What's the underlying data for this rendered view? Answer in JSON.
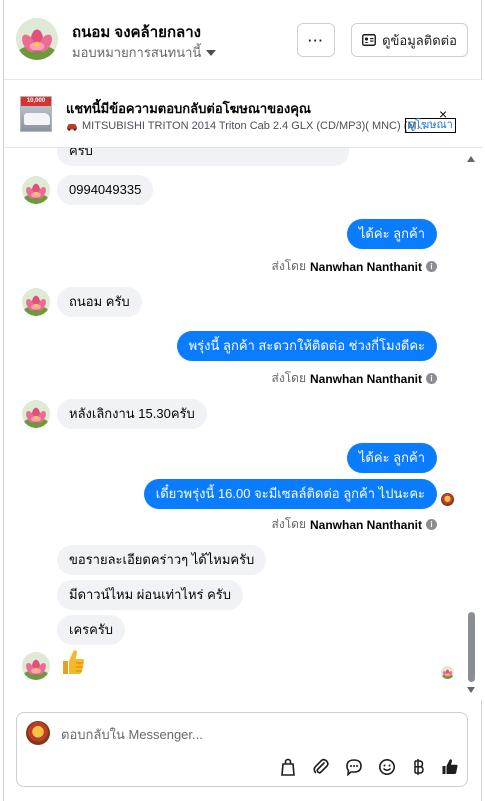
{
  "header": {
    "contact_name": "ถนอม จงคล้ายกลาง",
    "assign_label": "มอบหมายการสนทนานี้",
    "more_label": "···",
    "contact_info_label": "ดูข้อมูลติดต่อ"
  },
  "ad_banner": {
    "title": "แชทนี้มีข้อความตอบกลับต่อโฆษณาของคุณ",
    "subtitle": "MITSUBISHI TRITON 2014 Triton Cab 2.4 GLX (CD/MP3)( MNC) (M...",
    "link_label": "ดูโฆษณา",
    "thumb_tag": "10,000",
    "close_label": "×"
  },
  "messages": {
    "m0": "ครับ",
    "m1": "0994049335",
    "m2": "ได้ค่ะ  ลูกค้า",
    "m3": "ถนอม ครับ",
    "m4": "พรุ่งนี้ ลูกค้า สะดวกให้ติดต่อ ช่วงกี่โมงดีคะ",
    "m5": "หลังเลิกงาน 15.30ครับ",
    "m6": "ได้ค่ะ  ลูกค้า",
    "m7": "เดี๋ยวพรุ่งนี้ 16.00 จะมีเซลล์ติดต่อ ลูกค้า ไปนะคะ",
    "m8": "ขอรายละเอียดคร่าวๆ ได้ไหมครับ",
    "m9": "มีดาวน์ไหม ผ่อนเท่าไหร่ ครับ",
    "m10": "เครครับ",
    "m11": "👍"
  },
  "sent_by": {
    "prefix": "ส่งโดย",
    "agent": "Nanwhan Nanthanit",
    "info": "i"
  },
  "composer": {
    "placeholder": "ตอบกลับใน Messenger..."
  },
  "toolbar_icons": [
    "bag-icon",
    "attachment-icon",
    "saved-reply-icon",
    "emoji-icon",
    "payment-icon",
    "thumbs-up-icon"
  ],
  "colors": {
    "outgoing_bubble": "#0a7cff",
    "incoming_bubble": "#f0f2f5",
    "link": "#1b74e4"
  }
}
